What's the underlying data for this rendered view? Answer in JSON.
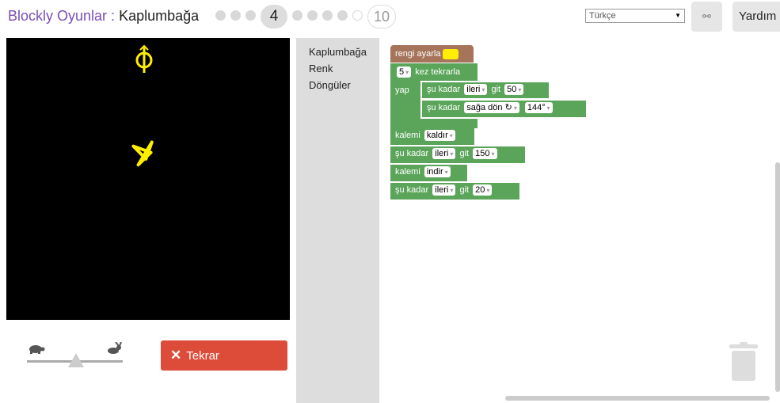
{
  "header": {
    "title_link": "Blockly Oyunlar",
    "title_sep": " : ",
    "title_game": "Kaplumbağa",
    "current_level": "4",
    "last_level": "10",
    "language": "Türkçe",
    "link_icon": "link-icon",
    "help_label": "Yardım"
  },
  "display": {
    "pen_color": "#ffee00",
    "background": "#000000"
  },
  "controls": {
    "slow_icon": "turtle-icon",
    "fast_icon": "rabbit-icon",
    "speed_level": 0.5,
    "run_label": "Tekrar",
    "run_icon": "close-icon"
  },
  "toolbox": {
    "categories": [
      "Kaplumbağa",
      "Renk",
      "Döngüler"
    ]
  },
  "blocks": {
    "set_color": {
      "label": "rengi ayarla",
      "color": "#ffee00"
    },
    "repeat": {
      "count": "5",
      "label": "kez tekrarla",
      "do_label": "yap"
    },
    "move1": {
      "prefix": "şu kadar",
      "dir": "ileri",
      "verb": "git",
      "value": "50"
    },
    "turn": {
      "prefix": "şu kadar",
      "dir": "sağa dön ↻",
      "value": "144°"
    },
    "pen_up": {
      "label": "kalemi",
      "value": "kaldır"
    },
    "move2": {
      "prefix": "şu kadar",
      "dir": "ileri",
      "verb": "git",
      "value": "150"
    },
    "pen_down": {
      "label": "kalemi",
      "value": "indir"
    },
    "move3": {
      "prefix": "şu kadar",
      "dir": "ileri",
      "verb": "git",
      "value": "20"
    }
  },
  "trash_icon": "trash-icon"
}
